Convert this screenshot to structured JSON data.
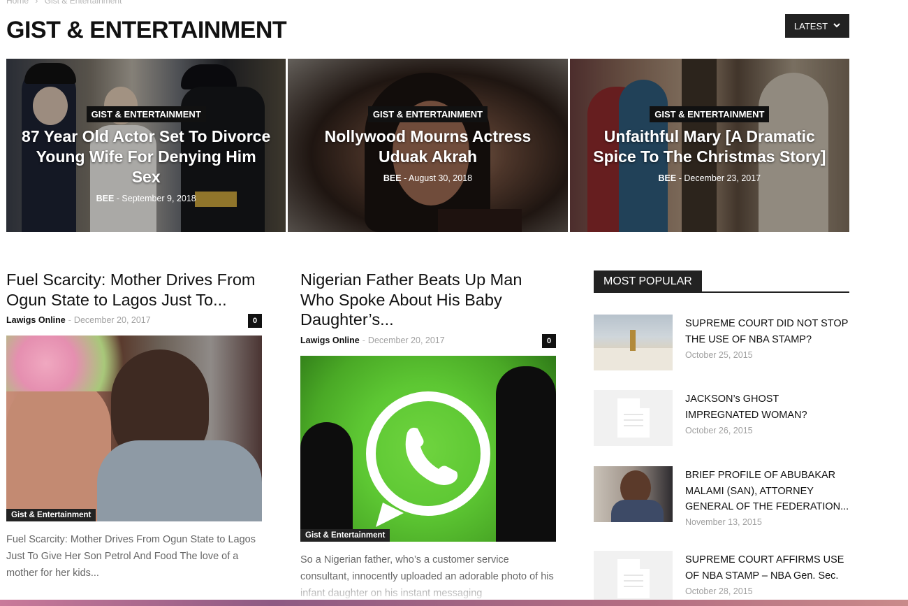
{
  "breadcrumb": {
    "home": "Home",
    "sep": "›",
    "current": "Gist & Entertainment"
  },
  "page": {
    "title": "GIST & ENTERTAINMENT"
  },
  "sort": {
    "label": "LATEST"
  },
  "heroes": [
    {
      "category": "GIST & ENTERTAINMENT",
      "title": "87 Year Old Actor Set To Divorce Young Wife For Denying Him Sex",
      "author": "BEE",
      "sep": "-",
      "date": "September 9, 2018"
    },
    {
      "category": "GIST & ENTERTAINMENT",
      "title": "Nollywood Mourns Actress Uduak Akrah",
      "author": "BEE",
      "sep": "-",
      "date": "August 30, 2018"
    },
    {
      "category": "GIST & ENTERTAINMENT",
      "title": "Unfaithful Mary [A Dramatic Spice To The Christmas Story]",
      "author": "BEE",
      "sep": "-",
      "date": "December 23, 2017"
    }
  ],
  "articles": [
    {
      "title": "Fuel Scarcity: Mother Drives From Ogun State to Lagos Just To...",
      "author": "Lawigs Online",
      "sep": "-",
      "date": "December 20, 2017",
      "comments": "0",
      "tag": "Gist & Entertainment",
      "excerpt": "Fuel Scarcity: Mother Drives From Ogun State to Lagos Just To Give Her Son Petrol And Food The love of a mother for her kids..."
    },
    {
      "title": "Nigerian Father Beats Up Man Who Spoke About His Baby Daughter’s...",
      "author": "Lawigs Online",
      "sep": "-",
      "date": "December 20, 2017",
      "comments": "0",
      "tag": "Gist & Entertainment",
      "excerpt": "So a Nigerian father, who’s a customer service consultant, innocently uploaded an adorable photo of his infant daughter on his instant messaging"
    }
  ],
  "popular": {
    "heading": "MOST POPULAR",
    "items": [
      {
        "title": "SUPREME COURT DID NOT STOP THE USE OF NBA STAMP?",
        "date": "October 25, 2015"
      },
      {
        "title": "JACKSON’s GHOST IMPREGNATED WOMAN?",
        "date": "October 26, 2015"
      },
      {
        "title": "BRIEF PROFILE OF ABUBAKAR MALAMI (SAN), ATTORNEY GENERAL OF THE FEDERATION...",
        "date": "November 13, 2015"
      },
      {
        "title": "SUPREME COURT AFFIRMS USE OF NBA STAMP – NBA Gen. Sec.",
        "date": "October 28, 2015"
      }
    ]
  }
}
